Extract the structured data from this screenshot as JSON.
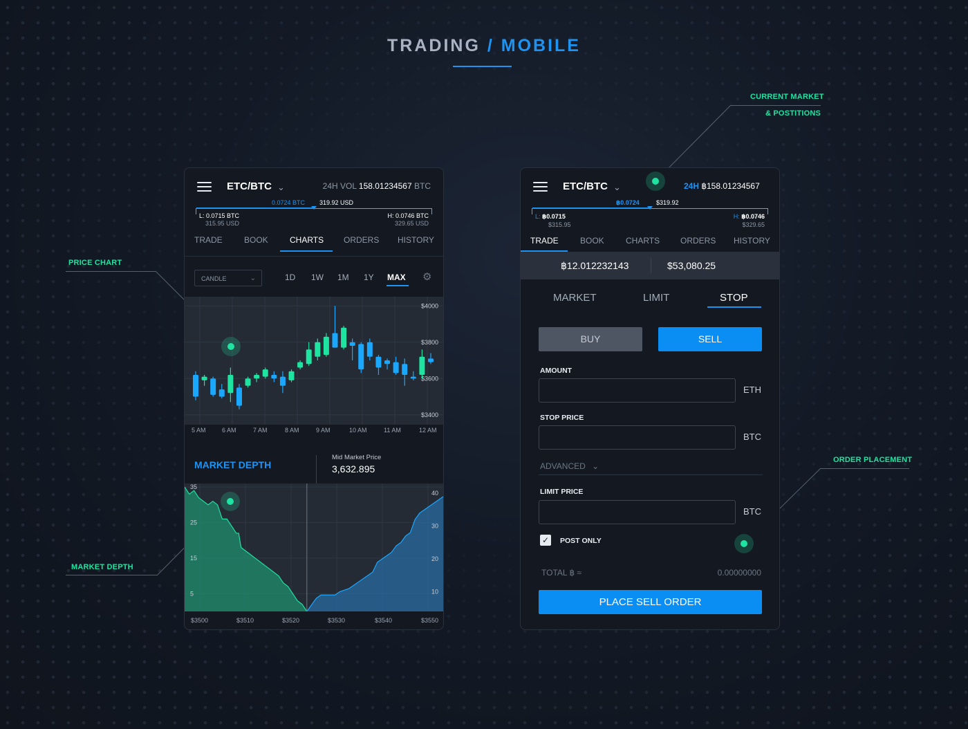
{
  "page": {
    "title_part1": "TRADING",
    "title_sep": "/",
    "title_part2": "MOBILE"
  },
  "annotations": {
    "price_chart": "PRICE CHART",
    "market_depth": "MARKET DEPTH",
    "current_market_line1": "CURRENT MARKET",
    "current_market_line2": "& POSTITIONS",
    "order_placement": "ORDER PLACEMENT"
  },
  "colors": {
    "accent": "#1e93f2",
    "highlight": "#1fe3a0",
    "bullish": "#1fe3a0",
    "bearish": "#1aa8ff",
    "background": "#131a26",
    "panel": "#141820"
  },
  "left_phone": {
    "header": {
      "menu_icon": "hamburger-icon",
      "pair": "ETC/BTC",
      "vol_label": "24H VOL",
      "vol_value": "158.01234567",
      "vol_unit": "BTC"
    },
    "range": {
      "current_btc": "0.0724 BTC",
      "current_usd": "319.92 USD",
      "low_label": "L: 0.0715 BTC",
      "low_usd": "315.95 USD",
      "high_label": "H: 0.0746 BTC",
      "high_usd": "329.65 USD"
    },
    "tabs": [
      "TRADE",
      "BOOK",
      "CHARTS",
      "ORDERS",
      "HISTORY"
    ],
    "active_tab": "CHARTS",
    "chart_controls": {
      "type_select": "CANDLE",
      "ranges": [
        "1D",
        "1W",
        "1M",
        "1Y",
        "MAX"
      ],
      "active_range": "MAX",
      "settings_icon": "gear-icon"
    },
    "depth": {
      "title": "MARKET DEPTH",
      "mid_label": "Mid Market Price",
      "mid_value": "3,632.895"
    }
  },
  "right_phone": {
    "header": {
      "menu_icon": "hamburger-icon",
      "pair": "ETC/BTC",
      "vol_label": "24H",
      "vol_value": "฿158.01234567"
    },
    "range": {
      "current_btc": "฿0.0724",
      "current_usd": "$319.92",
      "low_label": "L:",
      "low_btc": "฿0.0715",
      "low_usd": "$315.95",
      "high_label": "H:",
      "high_btc": "฿0.0746",
      "high_usd": "$329.65"
    },
    "tabs": [
      "TRADE",
      "BOOK",
      "CHARTS",
      "ORDERS",
      "HISTORY"
    ],
    "active_tab": "TRADE",
    "balance": {
      "btc": "฿12.012232143",
      "usd": "$53,080.25"
    },
    "order_types": [
      "MARKET",
      "LIMIT",
      "STOP"
    ],
    "active_order_type": "STOP",
    "buy_label": "BUY",
    "sell_label": "SELL",
    "amount": {
      "label": "AMOUNT",
      "value": "",
      "unit": "ETH"
    },
    "stop_price": {
      "label": "STOP PRICE",
      "value": "",
      "unit": "BTC"
    },
    "advanced_label": "ADVANCED",
    "limit_price": {
      "label": "LIMIT PRICE",
      "value": "",
      "unit": "BTC"
    },
    "post_only": {
      "label": "POST ONLY",
      "checked": true,
      "check_glyph": "✓"
    },
    "total_label": "TOTAL ฿ ≈",
    "total_value": "0.00000000",
    "place_button": "PLACE SELL ORDER"
  },
  "chart_data": [
    {
      "type": "candlestick",
      "title": "",
      "x_labels": [
        "5 AM",
        "6 AM",
        "7 AM",
        "8 AM",
        "9 AM",
        "10 AM",
        "11 AM",
        "12 AM"
      ],
      "y_ticks": [
        "$4000",
        "$3800",
        "$3600",
        "$3400"
      ],
      "ylim": [
        3380,
        4020
      ],
      "grid": true,
      "candles": [
        {
          "o": 3620,
          "h": 3640,
          "l": 3480,
          "c": 3500
        },
        {
          "o": 3590,
          "h": 3620,
          "l": 3560,
          "c": 3610
        },
        {
          "o": 3600,
          "h": 3610,
          "l": 3500,
          "c": 3510
        },
        {
          "o": 3540,
          "h": 3570,
          "l": 3490,
          "c": 3500
        },
        {
          "o": 3520,
          "h": 3660,
          "l": 3470,
          "c": 3620
        },
        {
          "o": 3550,
          "h": 3570,
          "l": 3430,
          "c": 3450
        },
        {
          "o": 3560,
          "h": 3610,
          "l": 3550,
          "c": 3600
        },
        {
          "o": 3600,
          "h": 3630,
          "l": 3580,
          "c": 3620
        },
        {
          "o": 3610,
          "h": 3660,
          "l": 3600,
          "c": 3650
        },
        {
          "o": 3620,
          "h": 3640,
          "l": 3580,
          "c": 3600
        },
        {
          "o": 3610,
          "h": 3640,
          "l": 3520,
          "c": 3560
        },
        {
          "o": 3590,
          "h": 3650,
          "l": 3580,
          "c": 3640
        },
        {
          "o": 3660,
          "h": 3700,
          "l": 3650,
          "c": 3690
        },
        {
          "o": 3680,
          "h": 3800,
          "l": 3670,
          "c": 3760
        },
        {
          "o": 3720,
          "h": 3820,
          "l": 3700,
          "c": 3800
        },
        {
          "o": 3730,
          "h": 3850,
          "l": 3720,
          "c": 3830
        },
        {
          "o": 3850,
          "h": 4000,
          "l": 3780,
          "c": 3770
        },
        {
          "o": 3770,
          "h": 3890,
          "l": 3760,
          "c": 3880
        },
        {
          "o": 3800,
          "h": 3820,
          "l": 3700,
          "c": 3780
        },
        {
          "o": 3790,
          "h": 3800,
          "l": 3630,
          "c": 3650
        },
        {
          "o": 3800,
          "h": 3820,
          "l": 3700,
          "c": 3720
        },
        {
          "o": 3720,
          "h": 3730,
          "l": 3620,
          "c": 3660
        },
        {
          "o": 3700,
          "h": 3710,
          "l": 3650,
          "c": 3680
        },
        {
          "o": 3690,
          "h": 3720,
          "l": 3620,
          "c": 3630
        },
        {
          "o": 3680,
          "h": 3710,
          "l": 3560,
          "c": 3620
        },
        {
          "o": 3610,
          "h": 3640,
          "l": 3590,
          "c": 3600
        },
        {
          "o": 3620,
          "h": 3760,
          "l": 3600,
          "c": 3720
        },
        {
          "o": 3710,
          "h": 3740,
          "l": 3680,
          "c": 3690
        }
      ]
    },
    {
      "type": "area",
      "title": "MARKET DEPTH",
      "x_labels": [
        "$3500",
        "$3510",
        "$3520",
        "$3530",
        "$3540",
        "$3550"
      ],
      "xlim": [
        3497,
        3552
      ],
      "left_y_ticks": [
        "35",
        "25",
        "15",
        "5"
      ],
      "left_ylim": [
        0,
        36
      ],
      "right_y_ticks": [
        "40",
        "30",
        "20",
        "10"
      ],
      "right_ylim": [
        4,
        43
      ],
      "series": [
        {
          "side": "bids",
          "color": "#1f8f6e",
          "x": [
            3497,
            3498,
            3499,
            3500,
            3501,
            3502,
            3503,
            3504,
            3505,
            3506,
            3507,
            3508,
            3508.5,
            3509,
            3510,
            3511,
            3512,
            3513,
            3514,
            3515,
            3516,
            3517,
            3518,
            3519,
            3520,
            3521,
            3522,
            3523
          ],
          "y": [
            35,
            33,
            34,
            32,
            31,
            30,
            31,
            30,
            26,
            26,
            24,
            22,
            22,
            18,
            17,
            16,
            15,
            14,
            13,
            12,
            11,
            10,
            8,
            7,
            5,
            3,
            2,
            0
          ]
        },
        {
          "side": "asks",
          "color": "#2a6fa8",
          "x": [
            3523,
            3524,
            3525,
            3526,
            3527,
            3528,
            3529,
            3530,
            3532,
            3533,
            3534,
            3535,
            3536,
            3537,
            3538,
            3539,
            3540,
            3541,
            3542,
            3543,
            3544,
            3545,
            3546,
            3547,
            3548,
            3549,
            3550,
            3551,
            3552
          ],
          "y": [
            4,
            6,
            8,
            9,
            9,
            9,
            9,
            10,
            11,
            12,
            13,
            14,
            15,
            16,
            19,
            20,
            21,
            22,
            24,
            25,
            27,
            28,
            32,
            34,
            35,
            36,
            37,
            38,
            39
          ]
        }
      ]
    }
  ]
}
